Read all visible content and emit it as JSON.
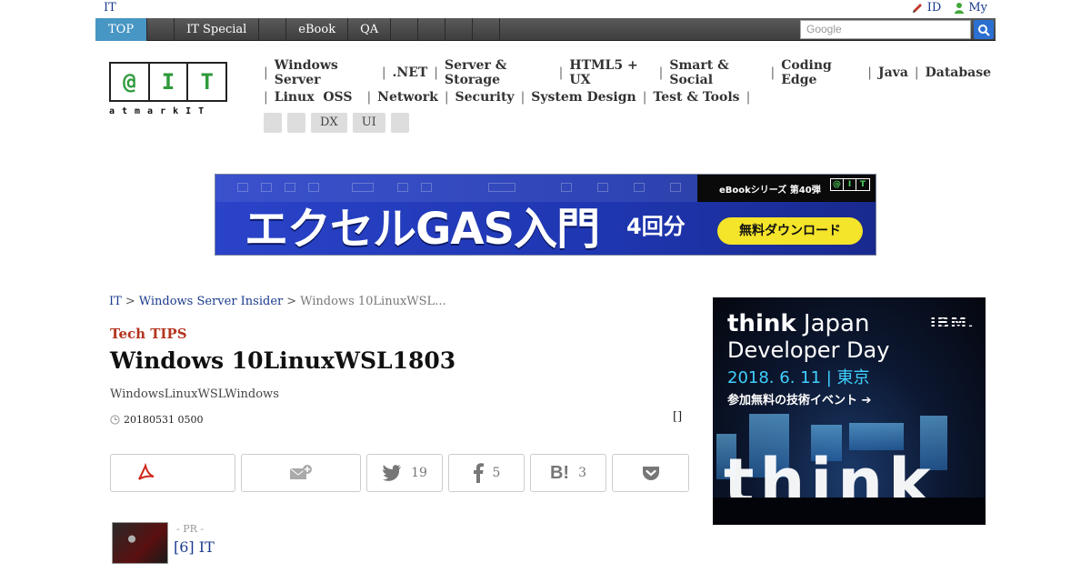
{
  "utility": {
    "home": "IT",
    "id_link": "ID",
    "my_link": "My"
  },
  "gnav": {
    "tabs": [
      "TOP",
      "",
      "IT Special",
      "",
      "eBook",
      "QA",
      "",
      "",
      "",
      ""
    ],
    "search_placeholder": "Google"
  },
  "logo": {
    "boxes": [
      "@",
      "I",
      "T"
    ],
    "sub": "atmarkIT"
  },
  "categories": {
    "row1": [
      "Windows Server",
      ".NET",
      "Server & Storage",
      "HTML5 + UX",
      "Smart & Social",
      "Coding Edge",
      "Java",
      "Database"
    ],
    "row2": [
      "Linux  OSS",
      "Network",
      "Security",
      "System Design",
      "Test & Tools"
    ],
    "pills": [
      "",
      "",
      "DX",
      "UI",
      ""
    ]
  },
  "banner": {
    "headline": "エクセルGAS入門",
    "sub": "4回分",
    "series": "eBookシリーズ 第40弾",
    "mini_logo": [
      "@",
      "I",
      "T"
    ],
    "download": "無料ダウンロード"
  },
  "breadcrumb": {
    "home": "IT",
    "section": "Windows Server Insider",
    "current": "Windows 10LinuxWSL..."
  },
  "article": {
    "kicker": "Tech TIPS",
    "title": "Windows 10LinuxWSL1803",
    "lead": "WindowsLinuxWSLWindows",
    "date": "20180531 0500",
    "bracket": "[]"
  },
  "share": {
    "twitter_count": "19",
    "facebook_count": "5",
    "hatena_count": "3"
  },
  "pr": {
    "label": "- PR -",
    "link": "[6] IT"
  },
  "ad": {
    "line1_bold": "think",
    "line1_rest": " Japan",
    "line2": "Developer Day",
    "line3": "2018. 6. 11 | 東京",
    "line4": "参加無料の技術イベント ➔",
    "brand": "IBM.",
    "big": "think"
  },
  "colors": {
    "accent_tab": "#4796c4",
    "kicker": "#b3361f",
    "link": "#1a3a8c",
    "logo_green": "#2e9a3a"
  }
}
